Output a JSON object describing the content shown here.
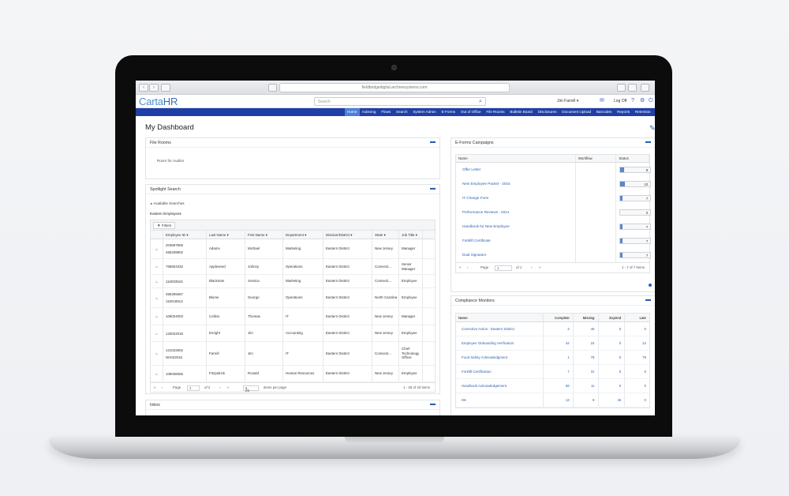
{
  "browser": {
    "url": "fieldbridgedigital.archivesystems.com"
  },
  "app": {
    "logo_a": "Carta",
    "logo_b": "HR",
    "search_placeholder": "Search",
    "user": "Jim Farrell",
    "log_off": "Log Off",
    "nav": [
      "Home",
      "Indexing",
      "Flows",
      "Search",
      "System Admin",
      "E-Forms",
      "Out of Office",
      "File Rooms",
      "Bulletin Board",
      "Disclosures",
      "Document Upload",
      "Barcodes",
      "Reports",
      "Retention"
    ],
    "nav_active": "Home"
  },
  "page_title": "My Dashboard",
  "file_rooms": {
    "title": "File Rooms",
    "items": [
      "Room for Auditor"
    ]
  },
  "spotlight": {
    "title": "Spotlight Search",
    "available": "Available Searches",
    "subtitle": "Eastern Employees",
    "filters_label": "Filters",
    "columns": [
      "Employee ID",
      "Last Name",
      "First Name",
      "Department",
      "Division/District",
      "State",
      "Job Title"
    ],
    "rows": [
      {
        "ids": [
          "203697906",
          "455339902"
        ],
        "last": "Adams",
        "first": "Michael",
        "dept": "Marketing",
        "div": "Eastern District",
        "state": "New Jersey",
        "job": "Manager"
      },
      {
        "ids": [
          "768804332"
        ],
        "last": "Appleseed",
        "first": "Johnny",
        "dept": "Operations",
        "div": "Eastern District",
        "state": "Connecti...",
        "job": "Senior Manager"
      },
      {
        "ids": [
          "116003515"
        ],
        "last": "Blackman",
        "first": "Jessica",
        "dept": "Marketing",
        "div": "Eastern District",
        "state": "Connecti...",
        "job": "Employee"
      },
      {
        "ids": [
          "455306667",
          "116018513"
        ],
        "last": "Blume",
        "first": "George",
        "dept": "Operations",
        "div": "Eastern District",
        "state": "North Carolina",
        "job": "Employee"
      },
      {
        "ids": [
          "109024003"
        ],
        "last": "Collins",
        "first": "Thomas",
        "dept": "IT",
        "div": "Eastern District",
        "state": "New Jersey",
        "job": "Manager"
      },
      {
        "ids": [
          "120022018"
        ],
        "last": "Enright",
        "first": "Jim",
        "dept": "Accounting",
        "div": "Eastern District",
        "state": "New Jersey",
        "job": "Employee"
      },
      {
        "ids": [
          "121022602",
          "NH022015"
        ],
        "last": "Farrell",
        "first": "Jim",
        "dept": "IT",
        "div": "Eastern District",
        "state": "Connecti...",
        "job": "Chief Technology Officer"
      },
      {
        "ids": [
          "109036065"
        ],
        "last": "Fitzpatrick",
        "first": "Ronald",
        "dept": "Human Resources",
        "div": "Eastern District",
        "state": "New Jersey",
        "job": "Employee"
      }
    ],
    "pager": {
      "page_label": "Page",
      "page": "1",
      "of": "of 2",
      "per_page": "25",
      "per_page_label": "items per page",
      "range": "1 - 25 of 43 items"
    }
  },
  "inbox": {
    "title": "Inbox"
  },
  "eforms": {
    "title": "E-Forms Campaigns",
    "columns": [
      "Name",
      "Workflow",
      "Status"
    ],
    "rows": [
      {
        "name": "Offer Letter",
        "count": "8",
        "fill": 0.12
      },
      {
        "name": "New Employee Packet - 2015",
        "count": "10",
        "fill": 0.15
      },
      {
        "name": "IT Change Form",
        "count": "7",
        "fill": 0.06
      },
      {
        "name": "Performance Reviews - 2014",
        "count": "0",
        "fill": 0
      },
      {
        "name": "Handbook for New Employee",
        "count": "7",
        "fill": 0.06
      },
      {
        "name": "Forklift Certificate",
        "count": "7",
        "fill": 0.06
      },
      {
        "name": "Dual Signature",
        "count": "7",
        "fill": 0.06
      }
    ],
    "pager": {
      "page_label": "Page",
      "page": "1",
      "of": "of 1",
      "range": "1 - 7 of 7 items"
    }
  },
  "compliance": {
    "title": "Compliance Monitors",
    "columns": [
      "Name",
      "Complete",
      "Missing",
      "Expired",
      "Late"
    ],
    "rows": [
      {
        "name": "Corrective Action - Eastern District",
        "complete": "3",
        "missing": "46",
        "expired": "0",
        "late": "0"
      },
      {
        "name": "Employee Onboarding Verification",
        "complete": "44",
        "missing": "24",
        "expired": "0",
        "late": "24"
      },
      {
        "name": "Food Safety Acknowledgment",
        "complete": "1",
        "missing": "79",
        "expired": "0",
        "late": "79"
      },
      {
        "name": "Forklift Certification",
        "complete": "7",
        "missing": "31",
        "expired": "0",
        "late": "0"
      },
      {
        "name": "Handbook Acknowledgement",
        "complete": "69",
        "missing": "11",
        "expired": "0",
        "late": "0"
      },
      {
        "name": "I9s",
        "complete": "13",
        "missing": "8",
        "expired": "46",
        "late": "0"
      }
    ]
  },
  "colors": {
    "nav": "#1f3fa6",
    "link": "#2b5fb4",
    "logo": "#4c8fd0"
  }
}
